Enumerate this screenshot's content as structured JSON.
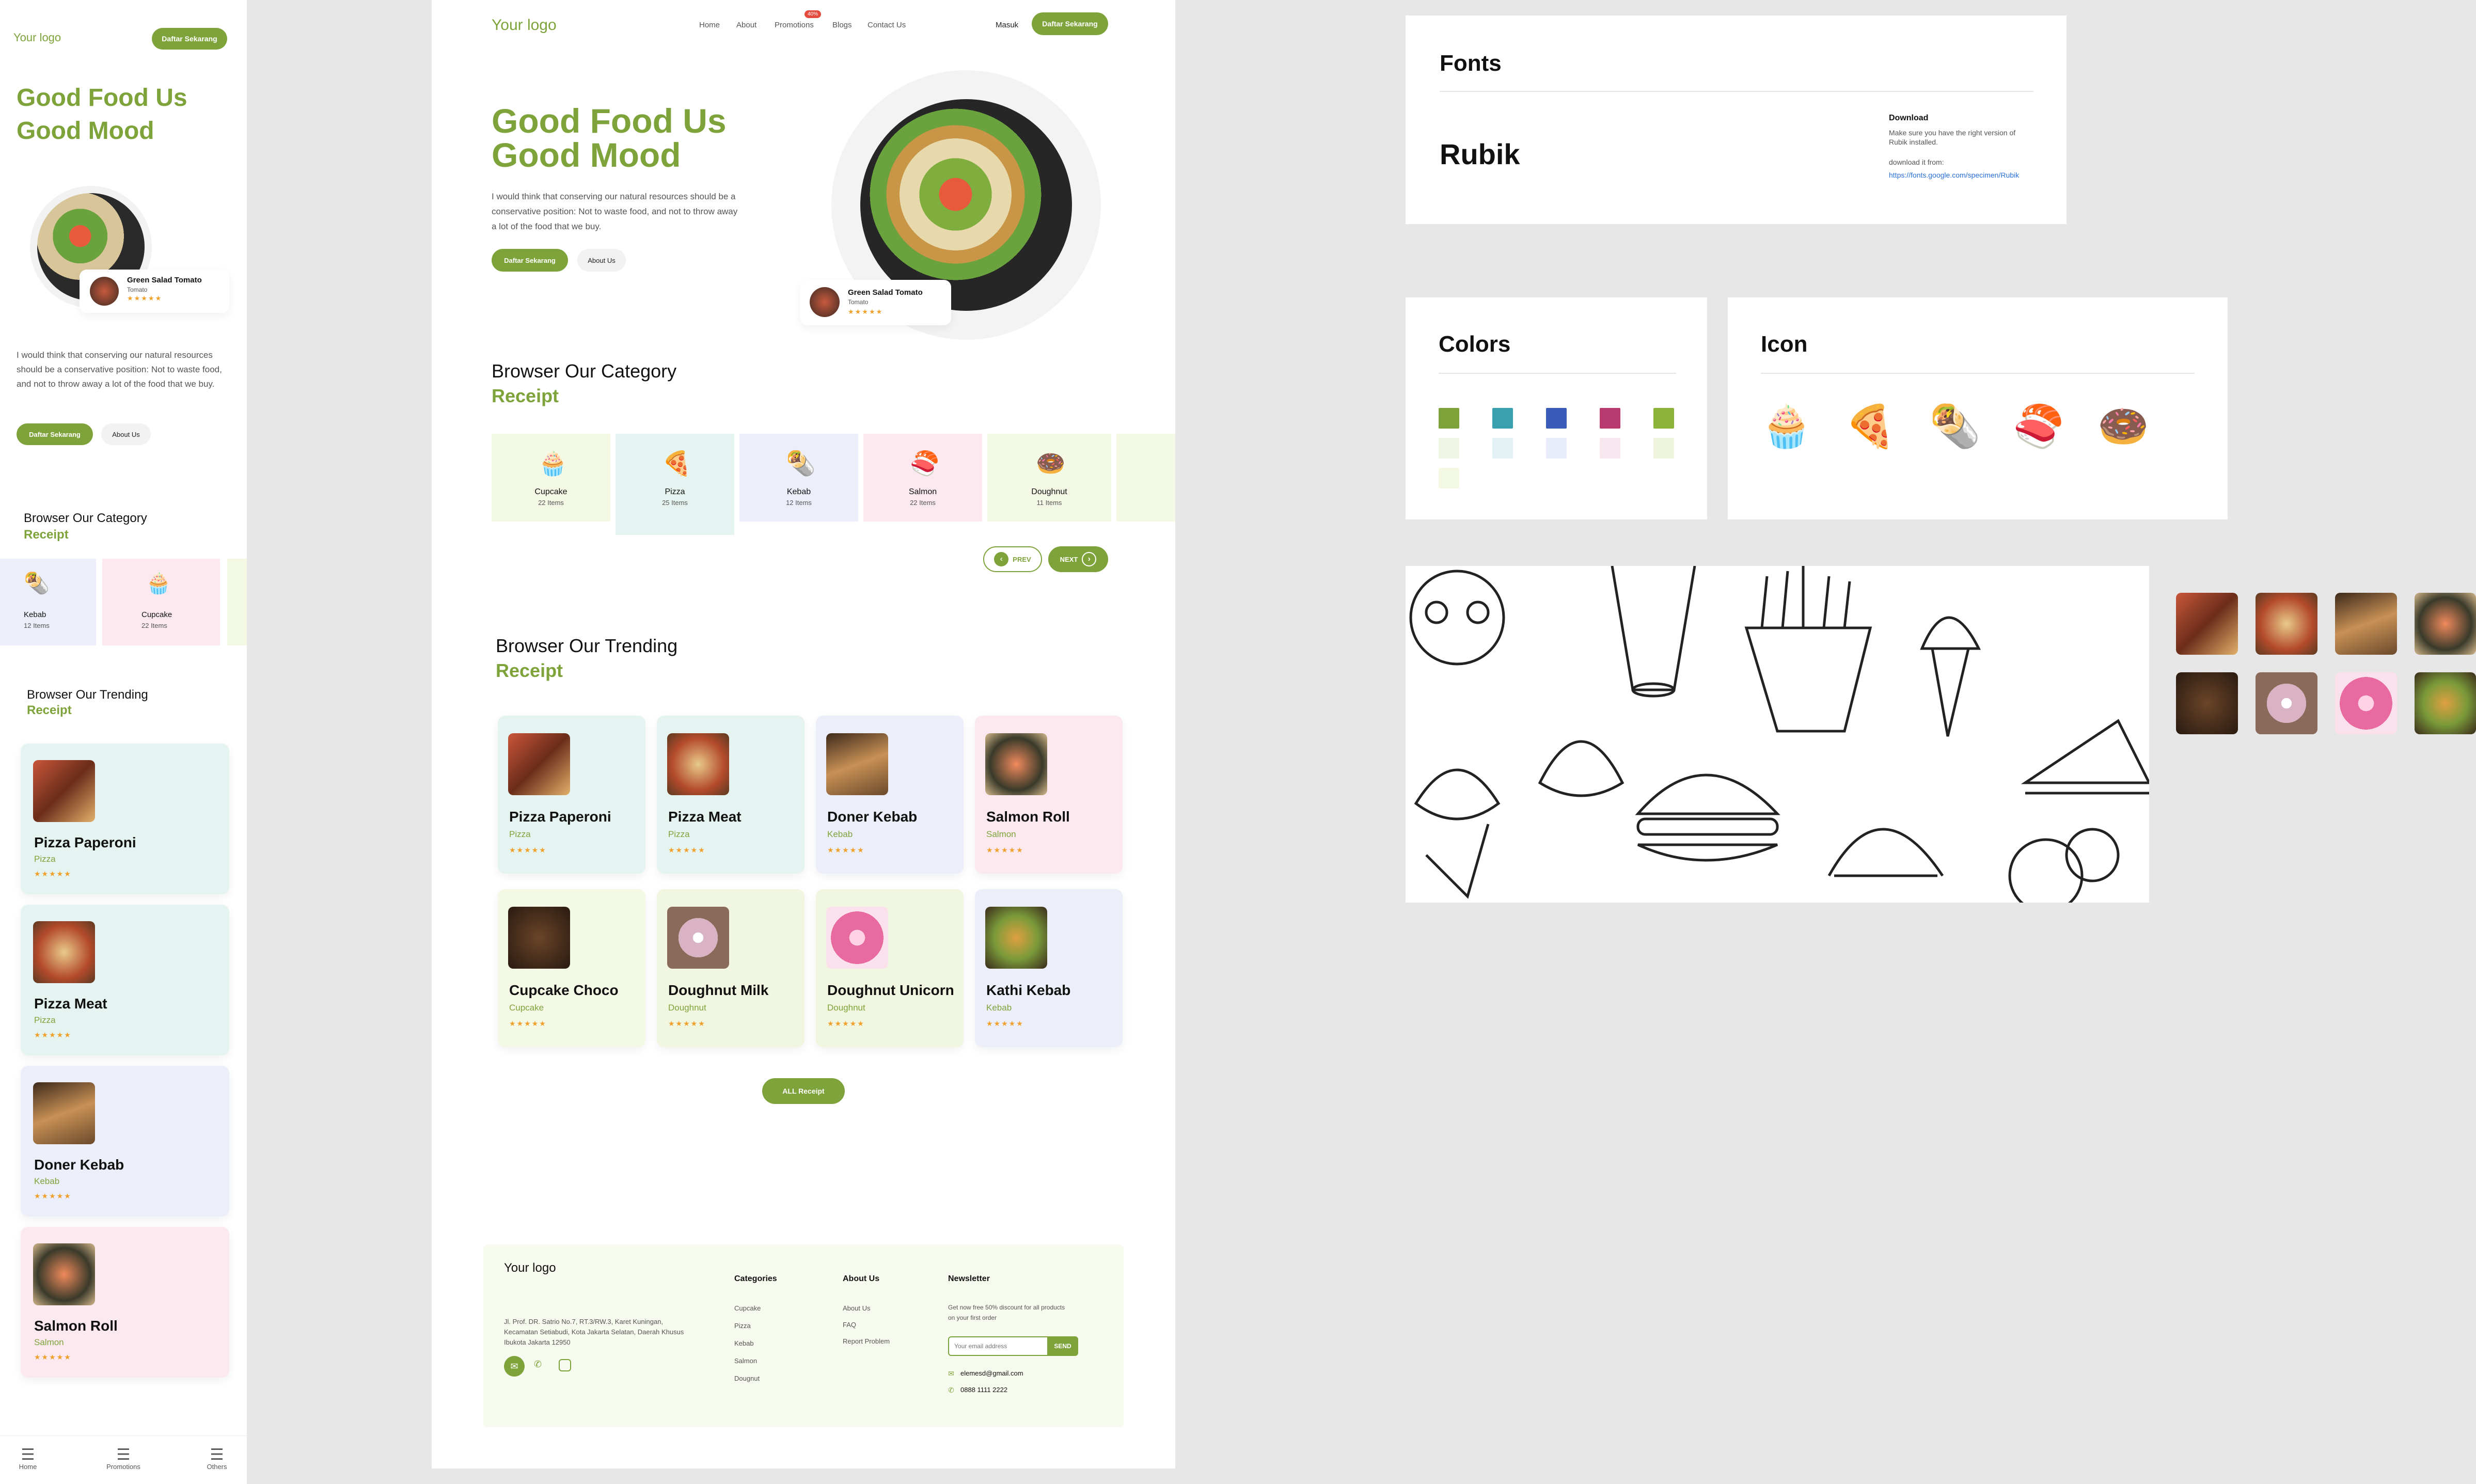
{
  "logo": "Your logo",
  "nav": {
    "home": "Home",
    "about": "About",
    "promotions": "Promotions",
    "promo_badge": "40%",
    "blogs": "Blogs",
    "contact": "Contact Us",
    "masuk": "Masuk",
    "daftar": "Daftar Sekarang"
  },
  "hero": {
    "title1": "Good Food Us",
    "title2": "Good Mood",
    "desc": "I would think that conserving our natural resources should be a conservative position: Not to waste food, and not to throw away a lot of the food that we buy.",
    "btn_daftar": "Daftar Sekarang",
    "btn_about": "About Us"
  },
  "dish": {
    "name": "Green Salad Tomato",
    "sub": "Tomato",
    "stars": "★★★★★"
  },
  "category": {
    "title": "Browser Our Category",
    "sub": "Receipt",
    "items": [
      {
        "name": "Cupcake",
        "count": "22 Items"
      },
      {
        "name": "Pizza",
        "count": "25 Items"
      },
      {
        "name": "Kebab",
        "count": "12 Items"
      },
      {
        "name": "Salmon",
        "count": "22 Items"
      },
      {
        "name": "Doughnut",
        "count": "11 Items"
      }
    ],
    "prev": "PREV",
    "next": "NEXT"
  },
  "trending": {
    "title": "Browser Our Trending",
    "sub": "Receipt",
    "items": [
      {
        "name": "Pizza Paperoni",
        "cat": "Pizza",
        "stars": "★★★★★"
      },
      {
        "name": "Pizza Meat",
        "cat": "Pizza",
        "stars": "★★★★★"
      },
      {
        "name": "Doner Kebab",
        "cat": "Kebab",
        "stars": "★★★★★"
      },
      {
        "name": "Salmon Roll",
        "cat": "Salmon",
        "stars": "★★★★★"
      },
      {
        "name": "Cupcake Choco",
        "cat": "Cupcake",
        "stars": "★★★★★"
      },
      {
        "name": "Doughnut Milk",
        "cat": "Doughnut",
        "stars": "★★★★★"
      },
      {
        "name": "Doughnut Unicorn",
        "cat": "Doughnut",
        "stars": "★★★★★"
      },
      {
        "name": "Kathi Kebab",
        "cat": "Kebab",
        "stars": "★★★★★"
      }
    ],
    "all": "ALL Receipt"
  },
  "footer": {
    "logo": "Your logo",
    "address": "Jl. Prof. DR. Satrio No.7, RT.3/RW.3, Karet Kuningan, Kecamatan Setiabudi, Kota Jakarta Selatan, Daerah Khusus Ibukota Jakarta 12950",
    "cat_title": "Categories",
    "cats": [
      "Cupcake",
      "Pizza",
      "Kebab",
      "Salmon",
      "Dougnut"
    ],
    "about_title": "About Us",
    "abouts": [
      "About Us",
      "FAQ",
      "Report Problem"
    ],
    "news_title": "Newsletter",
    "news_desc": "Get now free 50% discount for all products on your first order",
    "email_ph": "Your email address",
    "send": "SEND",
    "email": "elemesd@gmail.com",
    "phone": "0888 1111 2222"
  },
  "mobile": {
    "logo": "Your logo",
    "btn": "Daftar Sekarang",
    "title1": "Good Food Us",
    "title2": "Good Mood",
    "desc": "I would think that conserving our natural resources should be a conservative position: Not to waste food, and not to throw away a lot of the food that we buy.",
    "btn_daftar": "Daftar Sekarang",
    "btn_about": "About Us",
    "cat_title": "Browser Our Category",
    "cat_sub": "Receipt",
    "cats": [
      {
        "name": "Kebab",
        "count": "12 Items"
      },
      {
        "name": "Cupcake",
        "count": "22 Items"
      }
    ],
    "trend_title": "Browser Our Trending",
    "trend_sub": "Receipt",
    "trend": [
      {
        "name": "Pizza Paperoni",
        "cat": "Pizza"
      },
      {
        "name": "Pizza Meat",
        "cat": "Pizza"
      },
      {
        "name": "Doner Kebab",
        "cat": "Kebab"
      },
      {
        "name": "Salmon Roll",
        "cat": "Salmon"
      }
    ],
    "tabs": [
      "Home",
      "Promotions",
      "Others"
    ]
  },
  "fonts": {
    "title": "Fonts",
    "name": "Rubik",
    "dl_title": "Download",
    "dl_desc": "Make sure you have the right version of Rubik installed.",
    "dl_from": "download it from:",
    "dl_link": "https://fonts.google.com/specimen/Rubik"
  },
  "colors": {
    "title": "Colors",
    "main": [
      "#7ea33a",
      "#3a9fae",
      "#3a5bb8",
      "#b83a6f",
      "#8cb43a"
    ],
    "light": [
      "#eef6e3",
      "#e4f2f5",
      "#e8ecf8",
      "#f7e6ee",
      "#eef5dc"
    ]
  },
  "icons": {
    "title": "Icon",
    "items": [
      "cupcake-icon",
      "pizza-icon",
      "kebab-icon",
      "salmon-icon",
      "doughnut-icon"
    ]
  }
}
